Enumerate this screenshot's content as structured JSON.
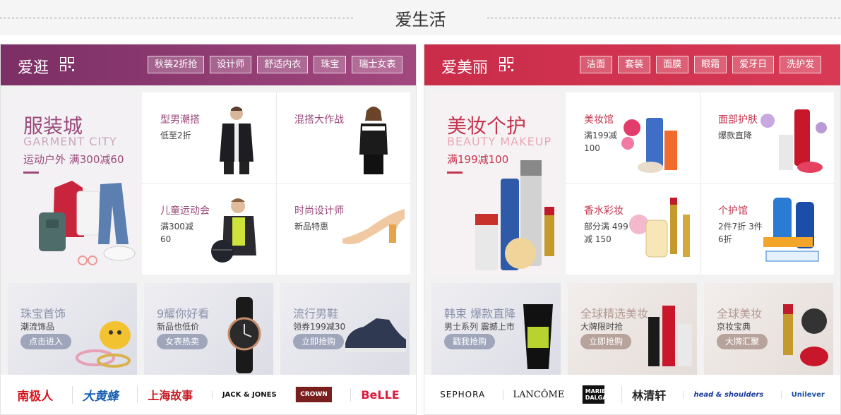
{
  "section_title": "爱生活",
  "left": {
    "title": "爱逛",
    "tags": [
      "秋装2折抢",
      "设计师",
      "舒适内衣",
      "珠宝",
      "瑞士女表"
    ],
    "feature": {
      "title": "服装城",
      "en": "GARMENT CITY",
      "sub": "运动户外 满300减60"
    },
    "cells": [
      {
        "title": "型男潮搭",
        "sub": "低至2折"
      },
      {
        "title": "混搭大作战",
        "sub": ""
      },
      {
        "title": "儿童运动会",
        "sub": "满300减 60"
      },
      {
        "title": "时尚设计师",
        "sub": "新品特惠"
      }
    ],
    "lower": [
      {
        "title": "珠宝首饰",
        "sub": "潮流饰品",
        "button": "点击进入"
      },
      {
        "title": "9耀你好看",
        "sub": "新品也低价",
        "button": "女表热卖"
      },
      {
        "title": "流行男鞋",
        "sub": "领券199减30",
        "button": "立即抢购"
      }
    ],
    "brands": [
      "南极人",
      "大黄蜂",
      "上海故事",
      "JACK & JONES",
      "CROWN",
      "BeLLE"
    ]
  },
  "right": {
    "title": "爱美丽",
    "tags": [
      "洁面",
      "套装",
      "面膜",
      "眼霜",
      "爱牙日",
      "洗护发"
    ],
    "feature": {
      "title": "美妆个护",
      "en": "BEAUTY MAKEUP",
      "sub": "满199减100"
    },
    "cells": [
      {
        "title": "美妆馆",
        "sub": "满199减 100"
      },
      {
        "title": "面部护肤",
        "sub": "爆款直降"
      },
      {
        "title": "香水彩妆",
        "sub": "部分满 499减 150"
      },
      {
        "title": "个护馆",
        "sub": "2件7折 3件6折"
      }
    ],
    "lower": [
      {
        "title": "韩束 爆款直降",
        "sub": "男士系列 震撼上市",
        "button": "戳我抢购"
      },
      {
        "title": "全球精选美妆",
        "sub": "大牌限时抢",
        "button": "立即抢购"
      },
      {
        "title": "全球美妆",
        "sub": "京妆宝典",
        "button": "大牌汇聚"
      }
    ],
    "brands": [
      "SEPHORA",
      "LANCÔME",
      "MARIE DALGAR",
      "林清轩",
      "head & shoulders",
      "Unilever"
    ]
  },
  "colors": {
    "left_bar": "#8e3a6e",
    "right_bar": "#d2344f",
    "left_text": "#9a4a7c",
    "right_text": "#c4364f"
  }
}
